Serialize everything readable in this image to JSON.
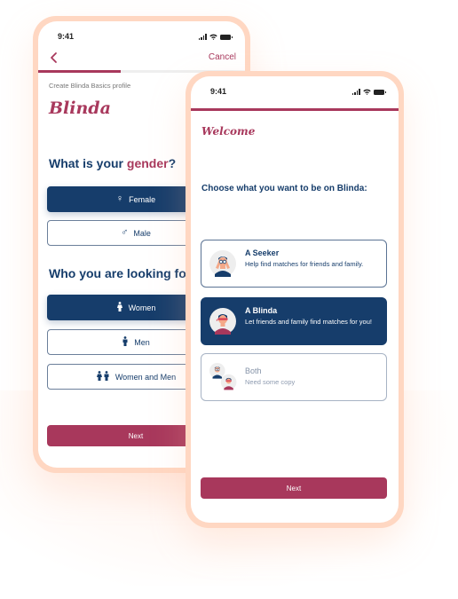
{
  "phone1": {
    "status": {
      "time": "9:41"
    },
    "nav": {
      "back_icon": "chevron-left-icon",
      "cancel_label": "Cancel"
    },
    "progress": {
      "fraction": 0.4
    },
    "subtitle": "Create Blinda Basics profile",
    "brand": "Blinda",
    "gender_question": {
      "prefix": "What is your ",
      "accent": "gender",
      "suffix": "?"
    },
    "gender_options": [
      {
        "label": "Female",
        "icon": "female-symbol-icon",
        "glyph": "♀",
        "selected": true
      },
      {
        "label": "Male",
        "icon": "male-symbol-icon",
        "glyph": "♂",
        "selected": false
      }
    ],
    "looking_question": "Who you are looking for",
    "looking_options": [
      {
        "label": "Women",
        "icon": "woman-icon",
        "glyph": "🚺",
        "selected": true
      },
      {
        "label": "Men",
        "icon": "man-icon",
        "glyph": "🚹",
        "selected": false
      },
      {
        "label": "Women and Men",
        "icon": "woman-and-man-icon",
        "glyph": "👫",
        "selected": false
      }
    ],
    "next_label": "Next"
  },
  "phone2": {
    "status": {
      "time": "9:41"
    },
    "welcome": "Welcome",
    "prompt": "Choose what you want to be on Blinda:",
    "roles": [
      {
        "title": "A Seeker",
        "description": "Help find matches for friends and family.",
        "selected": false,
        "avatar": "seeker-avatar"
      },
      {
        "title": "A Blinda",
        "description": "Let friends and family find matches for you!",
        "selected": true,
        "avatar": "blinda-avatar"
      },
      {
        "title": "Both",
        "description": "Need some copy",
        "selected": false,
        "avatar": "both-avatar"
      }
    ],
    "next_label": "Next"
  },
  "colors": {
    "brand": "#a8385c",
    "navy": "#163d6b",
    "frame": "#ffd7c2"
  }
}
